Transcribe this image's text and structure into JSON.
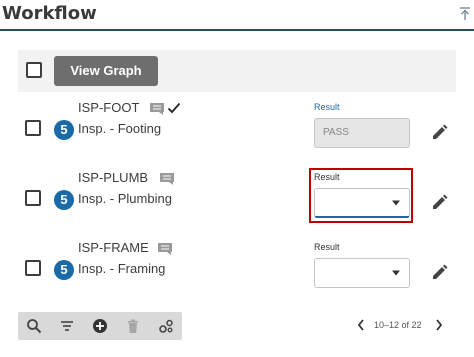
{
  "header": {
    "title": "Workflow",
    "collapse_icon": "collapse-up-icon"
  },
  "toolbar": {
    "view_graph_label": "View Graph"
  },
  "rows": [
    {
      "code": "ISP-FOOT",
      "badge": "5",
      "description": "Insp. - Footing",
      "result_label": "Result",
      "result_value": "PASS",
      "result_state": "readonly",
      "completed": true
    },
    {
      "code": "ISP-PLUMB",
      "badge": "5",
      "description": "Insp. - Plumbing",
      "result_label": "Result",
      "result_value": "",
      "result_state": "focused",
      "completed": false
    },
    {
      "code": "ISP-FRAME",
      "badge": "5",
      "description": "Insp. - Framing",
      "result_label": "Result",
      "result_value": "",
      "result_state": "empty",
      "completed": false
    }
  ],
  "bottom_toolbar": {
    "icons": [
      "search-icon",
      "filter-icon",
      "add-circle-icon",
      "delete-icon",
      "settings-icon"
    ]
  },
  "pager": {
    "range_text": "10–12 of 22"
  },
  "colors": {
    "accent_blue": "#1a6aa8",
    "header_rule": "#2b4a5f",
    "highlight_red": "#c00000",
    "button_gray": "#6e6e6e"
  }
}
